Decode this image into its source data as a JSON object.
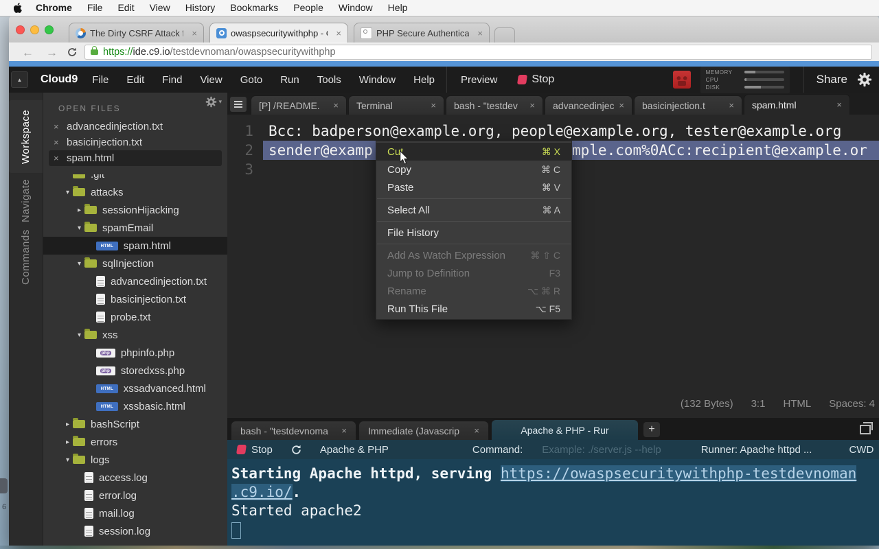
{
  "colors": {
    "blue_strip": "#5694d6",
    "stop_red": "#e23c5f",
    "selection": "#5a648c",
    "menu_highlight": "#ccdf55",
    "folder_olive": "#a6b33c",
    "terminal_bg": "#1b4156",
    "console_toolbar_bg": "#1d3b4a"
  },
  "glyphs": {
    "close": "×",
    "plus": "+",
    "collapse": "▲",
    "arrow_expanded": "▾",
    "arrow_collapsed": "▸",
    "back": "←",
    "forward": "→",
    "html_badge": "HTML",
    "php_badge": "php"
  },
  "desktop": {
    "number": "6"
  },
  "macos_menubar": {
    "items": [
      "Chrome",
      "File",
      "Edit",
      "View",
      "History",
      "Bookmarks",
      "People",
      "Window",
      "Help"
    ]
  },
  "browser": {
    "tabs": [
      {
        "title": "The Dirty CSRF Attack for",
        "active": false,
        "favicon": "csrf"
      },
      {
        "title": "owaspsecuritywithphp - Cl",
        "active": true,
        "favicon": "c9"
      },
      {
        "title": "PHP Secure Authentication",
        "active": false,
        "favicon": "page"
      }
    ],
    "url": {
      "scheme": "https://",
      "host": "ide.c9.io",
      "path": "/testdevnoman/owaspsecuritywithphp"
    }
  },
  "ide": {
    "menubar": {
      "brand": "Cloud9",
      "items": [
        "File",
        "Edit",
        "Find",
        "View",
        "Goto",
        "Run",
        "Tools",
        "Window",
        "Help"
      ],
      "preview_label": "Preview",
      "stop_label": "Stop",
      "share_label": "Share",
      "stats": [
        {
          "label": "MEMORY",
          "pct": 28
        },
        {
          "label": "CPU",
          "pct": 5
        },
        {
          "label": "DISK",
          "pct": 42
        }
      ]
    },
    "sidebar_tabs": [
      {
        "label": "Workspace",
        "active": true
      },
      {
        "label": "Navigate",
        "active": false
      },
      {
        "label": "Commands",
        "active": false
      }
    ],
    "workspace": {
      "open_files_header": "OPEN FILES",
      "open_files": [
        {
          "name": "advancedinjection.txt",
          "selected": false
        },
        {
          "name": "basicinjection.txt",
          "selected": false
        },
        {
          "name": "spam.html",
          "selected": true
        }
      ],
      "tree": [
        {
          "label": ".git",
          "icon": "folder",
          "indent": 0,
          "arrow": null,
          "partial": true
        },
        {
          "label": "attacks",
          "icon": "folder",
          "indent": 0,
          "arrow": "expanded"
        },
        {
          "label": "sessionHijacking",
          "icon": "folder",
          "indent": 1,
          "arrow": "collapsed"
        },
        {
          "label": "spamEmail",
          "icon": "folder",
          "indent": 1,
          "arrow": "expanded"
        },
        {
          "label": "spam.html",
          "icon": "html",
          "indent": 2,
          "arrow": null,
          "selected": true
        },
        {
          "label": "sqlInjection",
          "icon": "folder",
          "indent": 1,
          "arrow": "expanded"
        },
        {
          "label": "advancedinjection.txt",
          "icon": "txt",
          "indent": 2,
          "arrow": null
        },
        {
          "label": "basicinjection.txt",
          "icon": "txt",
          "indent": 2,
          "arrow": null
        },
        {
          "label": "probe.txt",
          "icon": "txt",
          "indent": 2,
          "arrow": null
        },
        {
          "label": "xss",
          "icon": "folder",
          "indent": 1,
          "arrow": "expanded"
        },
        {
          "label": "phpinfo.php",
          "icon": "php",
          "indent": 2,
          "arrow": null
        },
        {
          "label": "storedxss.php",
          "icon": "php",
          "indent": 2,
          "arrow": null
        },
        {
          "label": "xssadvanced.html",
          "icon": "html",
          "indent": 2,
          "arrow": null
        },
        {
          "label": "xssbasic.html",
          "icon": "html",
          "indent": 2,
          "arrow": null
        },
        {
          "label": "bashScript",
          "icon": "folder",
          "indent": 0,
          "arrow": "collapsed"
        },
        {
          "label": "errors",
          "icon": "folder",
          "indent": 0,
          "arrow": "collapsed"
        },
        {
          "label": "logs",
          "icon": "folder",
          "indent": 0,
          "arrow": "expanded"
        },
        {
          "label": "access.log",
          "icon": "txt",
          "indent": 1,
          "arrow": null
        },
        {
          "label": "error.log",
          "icon": "txt",
          "indent": 1,
          "arrow": null
        },
        {
          "label": "mail.log",
          "icon": "txt",
          "indent": 1,
          "arrow": null
        },
        {
          "label": "session.log",
          "icon": "txt",
          "indent": 1,
          "arrow": null
        }
      ]
    },
    "editor": {
      "tabs": [
        {
          "label": "[P] /README.",
          "active": false
        },
        {
          "label": "Terminal",
          "active": false
        },
        {
          "label": "bash - \"testdev",
          "active": false
        },
        {
          "label": "advancedinjec",
          "active": false
        },
        {
          "label": "basicinjection.t",
          "active": false
        },
        {
          "label": "spam.html",
          "active": true
        }
      ],
      "line_numbers": [
        "1",
        "2",
        "3"
      ],
      "code": {
        "line1": "Bcc: badperson@example.org, people@example.org, tester@example.org",
        "line2_left": "sender@examp",
        "line2_right": "mple.com%0ACc:recipient@example.or"
      },
      "statusbar": {
        "size": "(132 Bytes)",
        "cursor": "3:1",
        "mode": "HTML",
        "spaces": "Spaces: 4"
      }
    },
    "context_menu": {
      "items": [
        {
          "type": "item",
          "label": "Cut",
          "shortcut": "⌘ X",
          "state": "hover"
        },
        {
          "type": "item",
          "label": "Copy",
          "shortcut": "⌘ C",
          "state": "normal"
        },
        {
          "type": "item",
          "label": "Paste",
          "shortcut": "⌘ V",
          "state": "normal"
        },
        {
          "type": "separator"
        },
        {
          "type": "item",
          "label": "Select All",
          "shortcut": "⌘ A",
          "state": "normal"
        },
        {
          "type": "separator"
        },
        {
          "type": "item",
          "label": "File History",
          "shortcut": "",
          "state": "normal"
        },
        {
          "type": "separator"
        },
        {
          "type": "item",
          "label": "Add As Watch Expression",
          "shortcut": "⌘ ⇧ C",
          "state": "disabled"
        },
        {
          "type": "item",
          "label": "Jump to Definition",
          "shortcut": "F3",
          "state": "disabled"
        },
        {
          "type": "item",
          "label": "Rename",
          "shortcut": "⌥ ⌘ R",
          "state": "disabled"
        },
        {
          "type": "item",
          "label": "Run This File",
          "shortcut": "⌥ F5",
          "state": "normal"
        }
      ]
    },
    "console": {
      "tabs": [
        {
          "label": "bash - \"testdevnoma",
          "active": false,
          "closable": true
        },
        {
          "label": "Immediate (Javascrip",
          "active": false,
          "closable": true
        },
        {
          "label": "Apache & PHP - Rur",
          "active": true,
          "closable": false
        }
      ],
      "toolbar": {
        "stop_label": "Stop",
        "runner_name": "Apache & PHP",
        "command_label": "Command:",
        "command_placeholder": "Example: ./server.js --help",
        "runner_label": "Runner: Apache httpd ...",
        "cwd_label": "CWD"
      },
      "terminal": {
        "line1_text": "Starting Apache httpd, serving ",
        "line1_link": "https://owaspsecuritywithphp-testdevnoman",
        "line2_link": ".c9.io/",
        "line2_suffix": ".",
        "line3": "Started apache2"
      }
    }
  }
}
